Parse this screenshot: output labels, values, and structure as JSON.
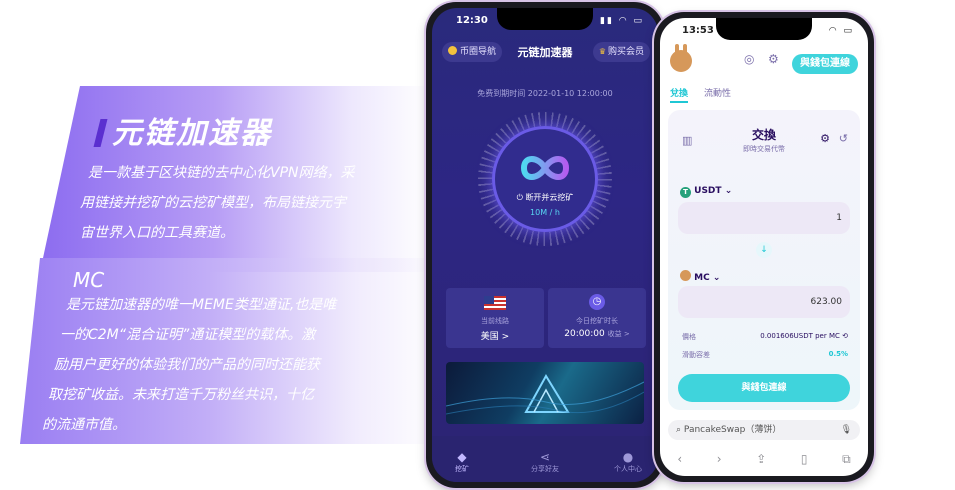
{
  "promo": {
    "title": "元链加速器",
    "desc1_line1": "是一款基于区块链的去中心化VPN网络，采",
    "desc1_line2": "用链接并挖矿的云挖矿模型，布局链接元宇",
    "desc1_line3": "宙世界入口的工具赛道。",
    "mc_title": "MC",
    "desc2_line1": "是元链加速器的唯一MEME类型通证,也是唯",
    "desc2_line2": "一的C2M“混合证明”通证模型的载体。激",
    "desc2_line3": "励用户更好的体验我们的产品的同时还能获",
    "desc2_line4": "取挖矿收益。未来打造千万粉丝共识，十亿",
    "desc2_line5": "的流通市值。"
  },
  "phone1": {
    "time": "12:30",
    "nav_left": "币圈导航",
    "app_title": "元链加速器",
    "nav_right": "购买会员",
    "expiry": "免费到期时间  2022-01-10  12:00:00",
    "disconnect_label": "断开并云挖矿",
    "speed": "10M / h",
    "line_label": "当前线路",
    "line_value": "美国 >",
    "mining_label": "今日挖矿时长",
    "mining_value": "20:00:00",
    "mining_link": "收益 >",
    "tabs": [
      "挖矿",
      "分享好友",
      "个人中心"
    ]
  },
  "phone2": {
    "time": "13:53",
    "connect_wallet": "與錢包連線",
    "tab_swap": "兌換",
    "tab_liquidity": "流動性",
    "swap_title": "交換",
    "swap_subtitle": "即時交易代幣",
    "from_token": "USDT",
    "from_value": "1",
    "to_token": "MC",
    "to_value": "623.00",
    "price_label": "價格",
    "price_value": "0.001606USDT  per  MC",
    "slippage_label": "滑動容差",
    "slippage_value": "0.5%",
    "connect_button": "與錢包連線",
    "search_text": "PancakeSwap（薄饼）"
  },
  "colors": {
    "accent_cyan": "#3fd4dc",
    "purple_dark": "#2a2470",
    "promo_purple": "#8c6cf0"
  }
}
